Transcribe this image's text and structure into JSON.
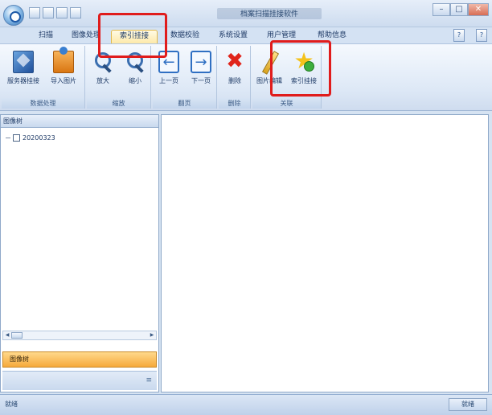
{
  "window": {
    "title": "档案扫描挂接软件"
  },
  "tabs": [
    {
      "label": "扫描"
    },
    {
      "label": "图像处理"
    },
    {
      "label": "索引挂接"
    },
    {
      "label": "数据校验"
    },
    {
      "label": "系统设置"
    },
    {
      "label": "用户管理"
    },
    {
      "label": "帮助信息"
    }
  ],
  "ribbon": {
    "groups": [
      {
        "label": "数据处理",
        "buttons": [
          {
            "label": "服务器挂接",
            "icon": "document-icon"
          },
          {
            "label": "导入图片",
            "icon": "import-icon"
          }
        ]
      },
      {
        "label": "缩放",
        "buttons": [
          {
            "label": "放大",
            "icon": "zoom-in-icon"
          },
          {
            "label": "缩小",
            "icon": "zoom-out-icon"
          }
        ]
      },
      {
        "label": "翻页",
        "buttons": [
          {
            "label": "上一页",
            "icon": "arrow-left-icon"
          },
          {
            "label": "下一页",
            "icon": "arrow-right-icon"
          }
        ]
      },
      {
        "label": "删除",
        "buttons": [
          {
            "label": "删除",
            "icon": "delete-icon"
          }
        ]
      },
      {
        "label": "关联",
        "buttons": [
          {
            "label": "图片编辑",
            "icon": "pencil-icon"
          },
          {
            "label": "索引挂接",
            "icon": "star-add-icon"
          }
        ]
      }
    ]
  },
  "left_panel": {
    "header": "图像树",
    "tree_root": "20200323",
    "nav_label": "图像树"
  },
  "status": {
    "left": "就绪",
    "right": "就绪"
  },
  "colors": {
    "highlight": "#e01c1c",
    "accent": "#f6a93b"
  }
}
